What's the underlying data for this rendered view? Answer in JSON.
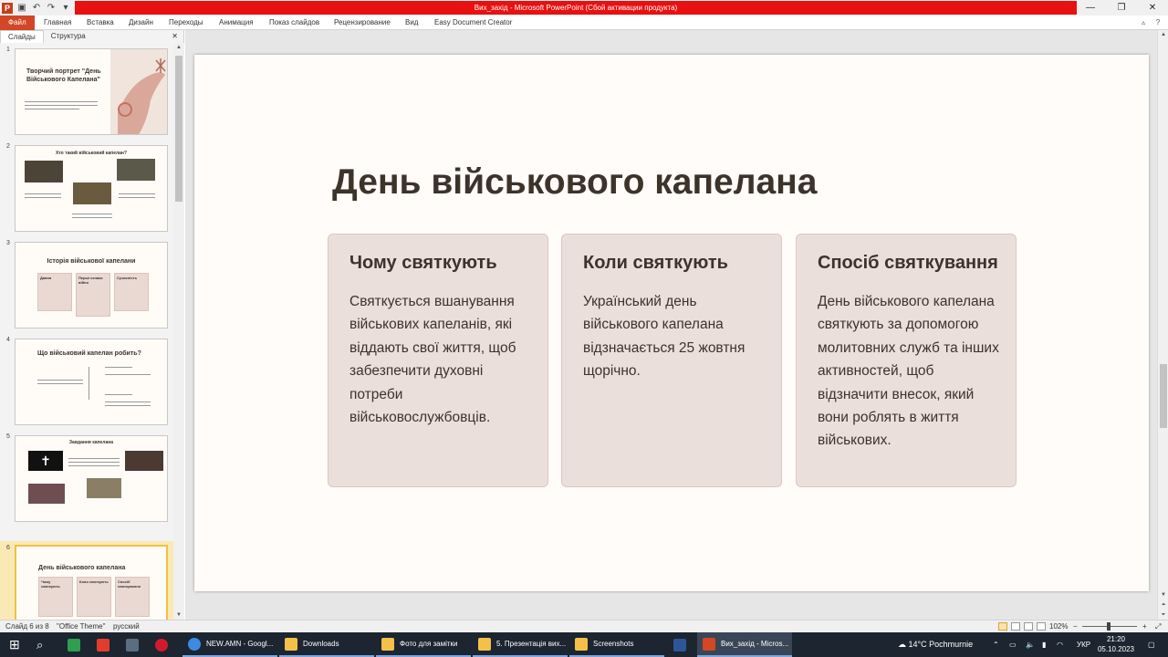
{
  "window": {
    "title": "Вих_захід  -  Microsoft PowerPoint (Сбой активации продукта)",
    "controls": [
      "—",
      "❐",
      "✕"
    ]
  },
  "ribbon": {
    "tabs": [
      "Файл",
      "Главная",
      "Вставка",
      "Дизайн",
      "Переходы",
      "Анимация",
      "Показ слайдов",
      "Рецензирование",
      "Вид",
      "Easy Document Creator"
    ]
  },
  "left_panel": {
    "tabs": [
      "Слайды",
      "Структура"
    ],
    "close": "✕",
    "thumbnails": [
      {
        "num": "1",
        "title": "Творчий портрет \"День Військового Капелана\""
      },
      {
        "num": "2",
        "title": "Хто такий військовий капелан?"
      },
      {
        "num": "3",
        "title": "Історія військової капелани",
        "boxes": [
          "Давня",
          "Перші ознаки війни",
          "Сучасність"
        ]
      },
      {
        "num": "4",
        "title": "Що військовий капелан робить?"
      },
      {
        "num": "5",
        "title": "Завдання капелана"
      },
      {
        "num": "6",
        "title": "День військового капелана",
        "boxes": [
          "Чому святкують",
          "Коли святкують",
          "Спосіб святкування"
        ]
      }
    ]
  },
  "slide": {
    "title": "День військового капелана",
    "cards": [
      {
        "heading": "Чому святкують",
        "body": "Святкується вшанування військових капеланів, які віддають свої життя, щоб забезпечити духовні потреби військовослужбовців."
      },
      {
        "heading": "Коли святкують",
        "body": "Український день військового капелана відзначається 25 жовтня щорічно."
      },
      {
        "heading": "Спосіб святкування",
        "body": "День військового капелана святкують за допомогою молитовних служб та інших активностей, щоб відзначити внесок, який вони роблять в життя військових."
      }
    ]
  },
  "statusbar": {
    "slide_info": "Слайд 6 из 8",
    "theme": "\"Office Theme\"",
    "language": "русский",
    "zoom": "102%",
    "zoom_minus": "−",
    "zoom_plus": "+"
  },
  "taskbar": {
    "apps": [
      {
        "label": "NEW.AMN - Googl..."
      },
      {
        "label": "Downloads"
      },
      {
        "label": "Фото для замітки"
      },
      {
        "label": "5. Презентація вих..."
      },
      {
        "label": "Screenshots"
      },
      {
        "label": "Вих_захід - Micros..."
      }
    ],
    "weather": "14°C  Pochmurnie",
    "lang": "УКР",
    "time": "21:20",
    "date": "05.10.2023"
  }
}
